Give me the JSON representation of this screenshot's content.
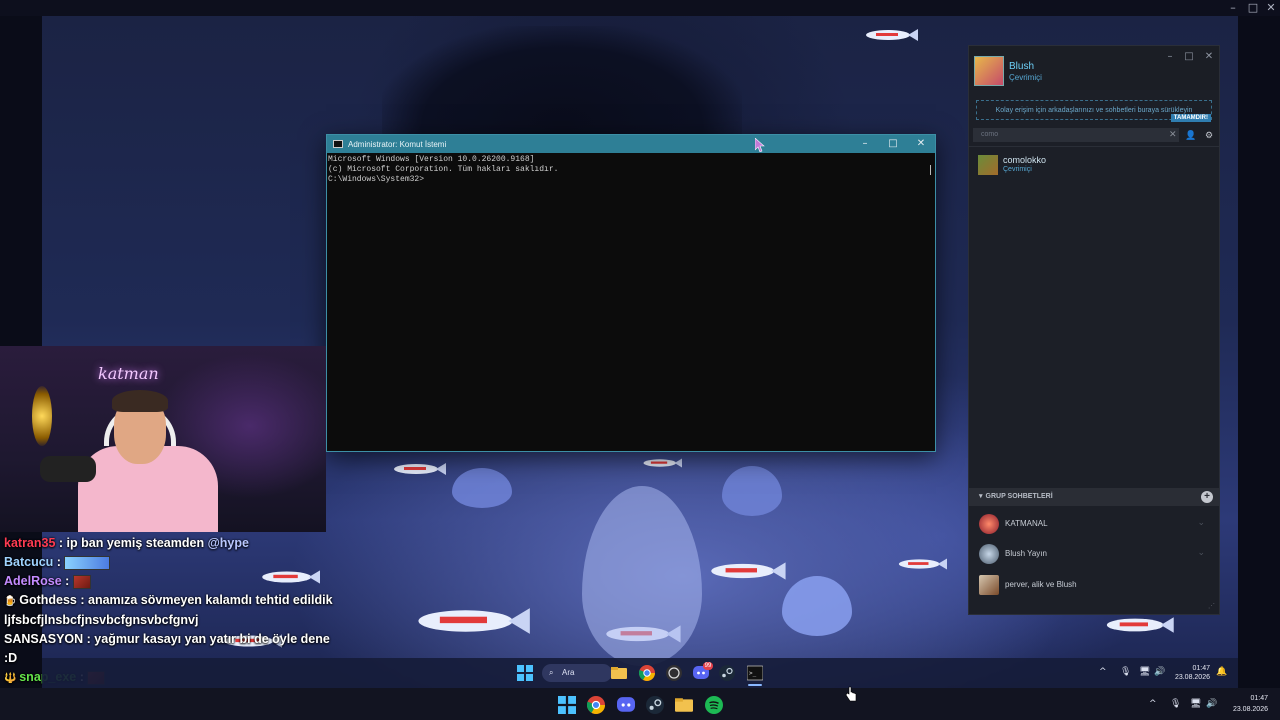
{
  "cmd": {
    "title": "Administrator: Komut İstemi",
    "line1": "Microsoft Windows [Version 10.0.26200.9168]",
    "line2": "(c) Microsoft Corporation. Tüm hakları saklıdır.",
    "line3": "",
    "line4": "C:\\Windows\\System32>"
  },
  "steam": {
    "username": "Blush",
    "status": "Çevrimiçi",
    "drop_hint": "Kolay erişim için arkadaşlarınızı ve sohbetleri buraya sürükleyin",
    "done_label": "TAMAMDIR!",
    "search_value": "como",
    "friend": {
      "name": "comolokko",
      "status": "Çevrimiçi"
    },
    "groups_header": "GRUP SOHBETLERİ",
    "groups": [
      {
        "name": "KATMANAL"
      },
      {
        "name": "Blush Yayın"
      },
      {
        "name": "perver, alik ve Blush"
      }
    ]
  },
  "webcam": {
    "neon_sign": "katman"
  },
  "chat": [
    {
      "user": "katran35",
      "color": "#ff3b52",
      "text": " : ip ban yemiş steamden ",
      "mention": "@hype"
    },
    {
      "user": "Batcucu",
      "color": "#9fd3ff",
      "text": " : "
    },
    {
      "user": "AdelRose",
      "color": "#c48bff",
      "text": " : "
    },
    {
      "user": "Gothdess",
      "color": "#ffffff",
      "text": " : anamıza sövmeyen kalamdı tehtid edildik"
    },
    {
      "user": "",
      "color": "#ffffff",
      "text": "ljfsbcfjlnsbcfjnsvbcfgnsvbcfgnvj"
    },
    {
      "user": "SANSASYON",
      "color": "#ffffff",
      "text": " : yağmur kasayı yan yatır bi de öyle dene"
    },
    {
      "user": "",
      "color": "#ffffff",
      "text": ":D"
    },
    {
      "user": "snap_exe",
      "color": "#64e24a",
      "text": " : "
    }
  ],
  "inner_taskbar": {
    "search_label": "Ara",
    "discord_badge": "99",
    "time": "01:47",
    "date": "23.08.2026"
  },
  "outer_taskbar": {
    "time": "01:47",
    "date": "23.08.2026"
  },
  "icons": {
    "minimize": "minimize-icon",
    "maximize": "maximize-icon",
    "close": "close-icon",
    "windows": "windows-start-icon",
    "chrome": "chrome-icon",
    "discord": "discord-icon",
    "steam": "steam-icon",
    "explorer": "folder-icon",
    "spotify": "spotify-icon",
    "terminal": "terminal-icon"
  },
  "colors": {
    "cmd_titlebar": "#2e7f96",
    "steam_accent": "#6dcff6",
    "steam_bg": "#1c1f27",
    "chat_green": "#64e24a"
  }
}
